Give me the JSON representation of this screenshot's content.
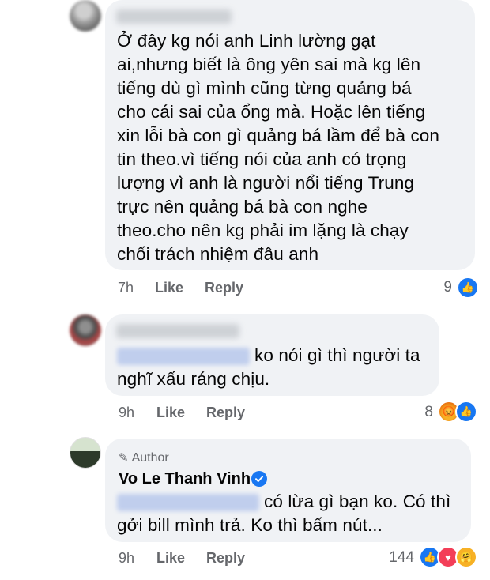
{
  "comments": [
    {
      "lines": [
        "Ở đây kg nói anh Linh lường gạt",
        "ai,nhưng biết là ông yên sai mà kg lên",
        "tiếng dù gì mình cũng từng quảng bá",
        "cho cái sai của ổng mà. Hoặc lên tiếng",
        "xin lỗi bà con gì quảng bá lầm để bà con",
        "tin theo.vì tiếng nói của anh có trọng",
        "lượng vì anh là người nổi tiếng Trung",
        "trực nên quảng bá bà con nghe",
        "theo.cho nên kg phải im lặng là chạy",
        "chối trách nhiệm đâu anh"
      ],
      "time": "7h",
      "like_label": "Like",
      "reply_label": "Reply",
      "reaction_count": "9",
      "reactions": [
        "like-icon"
      ]
    },
    {
      "line1": "ko nói gì thì người ta",
      "line2": "nghĩ xấu ráng chịu.",
      "time": "9h",
      "like_label": "Like",
      "reply_label": "Reply",
      "reaction_count": "8",
      "reactions": [
        "angry-icon",
        "like-icon"
      ]
    },
    {
      "author_label": "Author",
      "name": "Vo Le Thanh Vinh",
      "line1": "có lừa gì bạn ko. Có thì",
      "line2": "gởi bill mình trả. Ko thì bấm nút...",
      "time": "9h",
      "like_label": "Like",
      "reply_label": "Reply",
      "reaction_count": "144",
      "reactions": [
        "like-icon",
        "love-icon",
        "care-icon"
      ]
    }
  ],
  "colors": {
    "bubble": "#f0f2f5",
    "meta": "#65676b",
    "like_blue": "#1877f2"
  }
}
